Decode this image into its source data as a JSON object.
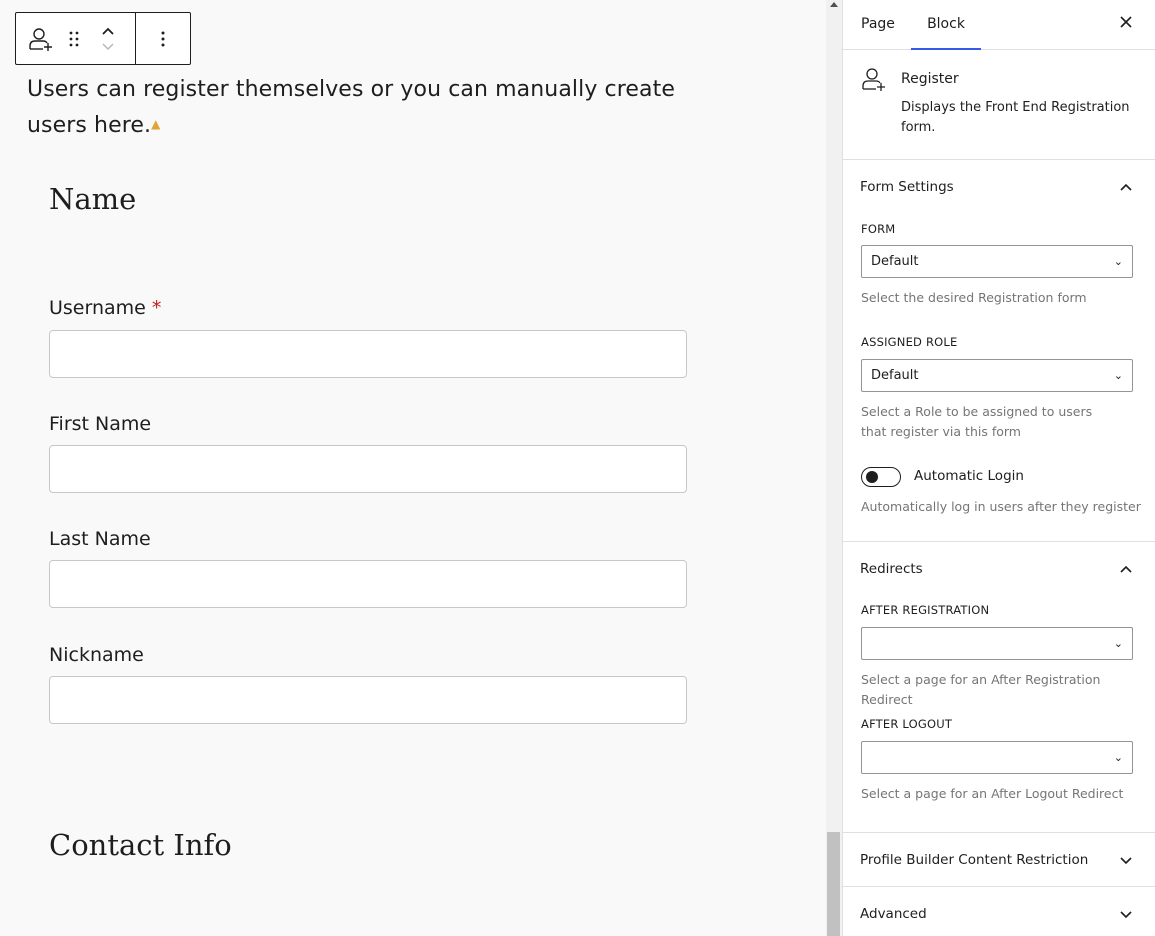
{
  "canvas": {
    "intro_text": "Users can register themselves or you can manually create users here.",
    "sections": {
      "name_heading": "Name",
      "contact_heading": "Contact Info"
    },
    "fields": [
      {
        "label": "Username",
        "required_mark": "*",
        "value": ""
      },
      {
        "label": "First Name",
        "value": ""
      },
      {
        "label": "Last Name",
        "value": ""
      },
      {
        "label": "Nickname",
        "value": ""
      }
    ]
  },
  "toolbar": {
    "icons": [
      "user-add-icon",
      "drag-handle-icon",
      "move-up-icon",
      "move-down-icon",
      "more-options-icon"
    ]
  },
  "sidebar": {
    "tabs": [
      {
        "label": "Page",
        "active": false
      },
      {
        "label": "Block",
        "active": true
      }
    ],
    "close_icon": "close-icon",
    "block_card": {
      "title": "Register",
      "description": "Displays the Front End Registration form."
    },
    "form_settings": {
      "title": "Form Settings",
      "form_label": "FORM",
      "form_value": "Default",
      "form_help": "Select the desired Registration form",
      "role_label": "ASSIGNED ROLE",
      "role_value": "Default",
      "role_help": "Select a Role to be assigned to users that register via this form",
      "auto_login_label": "Automatic Login",
      "auto_login_enabled": false,
      "auto_login_help": "Automatically log in users after they register"
    },
    "redirects": {
      "title": "Redirects",
      "after_registration_label": "AFTER REGISTRATION",
      "after_registration_value": "",
      "after_registration_help": "Select a page for an After Registration Redirect",
      "after_logout_label": "AFTER LOGOUT",
      "after_logout_value": "",
      "after_logout_help": "Select a page for an After Logout Redirect"
    },
    "content_restriction": {
      "title": "Profile Builder Content Restriction"
    },
    "advanced": {
      "title": "Advanced"
    }
  },
  "colors": {
    "accent": "#3858e9",
    "required": "#cc1818",
    "warning": "#e0a43a"
  }
}
